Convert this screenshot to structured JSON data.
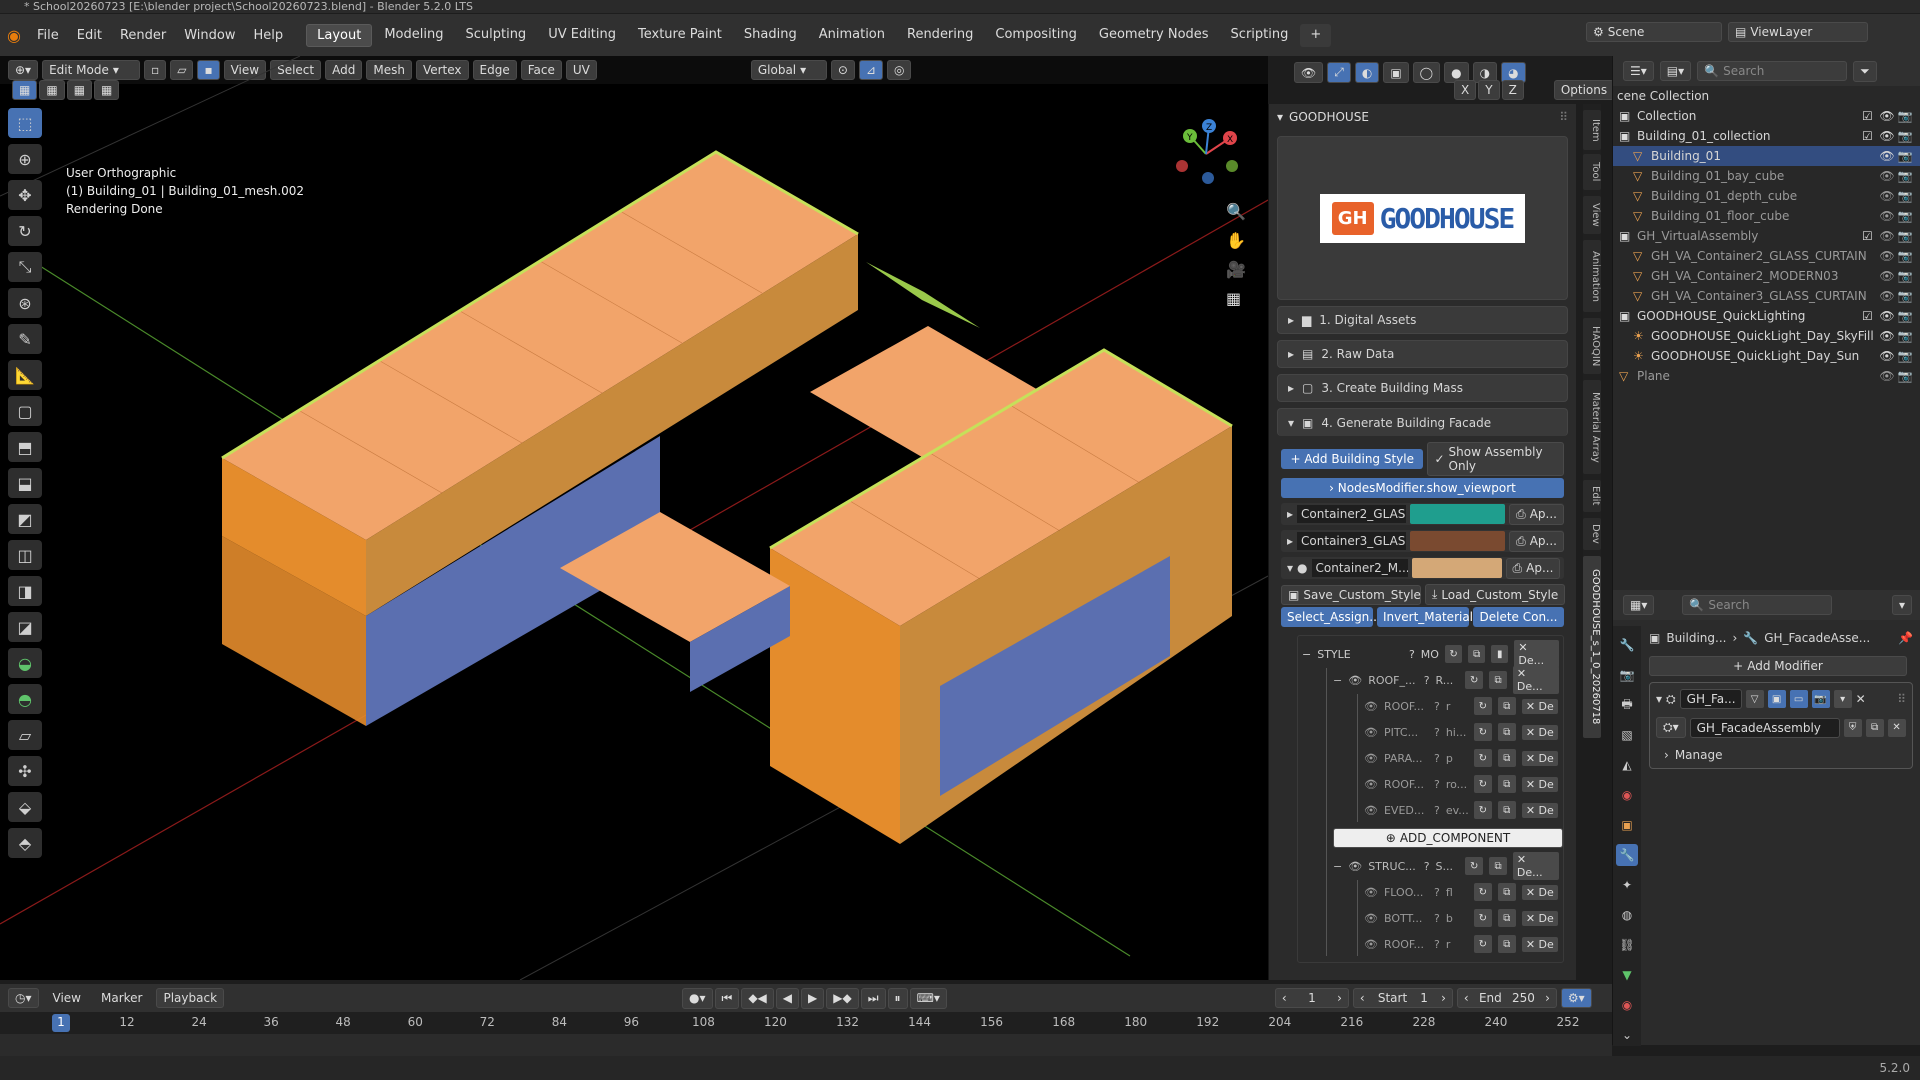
{
  "window": {
    "title": "* School20260723 [E:\\blender project\\School20260723.blend] - Blender 5.2.0 LTS"
  },
  "menu": [
    "File",
    "Edit",
    "Render",
    "Window",
    "Help"
  ],
  "workspaces": [
    "Layout",
    "Modeling",
    "Sculpting",
    "UV Editing",
    "Texture Paint",
    "Shading",
    "Animation",
    "Rendering",
    "Compositing",
    "Geometry Nodes",
    "Scripting"
  ],
  "active_workspace": "Layout",
  "scene": {
    "name": "Scene",
    "view_layer": "ViewLayer"
  },
  "viewport": {
    "mode": "Edit Mode",
    "menus": [
      "View",
      "Select",
      "Add",
      "Mesh",
      "Vertex",
      "Edge",
      "Face",
      "UV"
    ],
    "transform_orientation": "Global",
    "options": "Options",
    "axes": [
      "X",
      "Y",
      "Z"
    ],
    "overlay": {
      "view": "User Orthographic",
      "object": "(1) Building_01 | Building_01_mesh.002",
      "status": "Rendering Done"
    }
  },
  "npanel": {
    "title": "GOODHOUSE",
    "logo_text": "GOODHOUSE",
    "logo_mark": "GH",
    "sections": [
      "1. Digital Assets",
      "2. Raw Data",
      "3. Create Building Mass",
      "4. Generate Building Facade"
    ],
    "add_style": "Add Building Style",
    "show_assembly": "Show Assembly Only",
    "nodes_modifier": "NodesModifier.show_viewport",
    "containers": [
      {
        "name": "Container2_GLAS...",
        "color": "#1f9e8e",
        "apply": "Ap..."
      },
      {
        "name": "Container3_GLAS...",
        "color": "#7a4a30",
        "apply": "Ap..."
      },
      {
        "name": "Container2_M...",
        "color": "#d4a877",
        "apply": "Ap..."
      }
    ],
    "custom_style": {
      "save": "Save_Custom_Style",
      "load": "Load_Custom_Style"
    },
    "assign_row": [
      "Select_Assign...",
      "Invert_Material...",
      "Delete Con..."
    ],
    "style": {
      "label": "STYLE",
      "mode": "MO",
      "delete": "De..."
    },
    "roof_group": {
      "label": "ROOF_...",
      "short": "R...",
      "delete": "De..."
    },
    "roof_items": [
      {
        "name": "ROOF...",
        "sub": "r"
      },
      {
        "name": "PITC...",
        "sub": "hi..."
      },
      {
        "name": "PARA...",
        "sub": "p"
      },
      {
        "name": "ROOF...",
        "sub": "ro..."
      },
      {
        "name": "EVED...",
        "sub": "ev..."
      }
    ],
    "add_component": "ADD_COMPONENT",
    "struct_group": {
      "label": "STRUC...",
      "short": "S...",
      "delete": "De..."
    },
    "struct_items": [
      {
        "name": "FLOO...",
        "sub": "fl"
      },
      {
        "name": "BOTT...",
        "sub": "b"
      },
      {
        "name": "ROOF...",
        "sub": "r"
      }
    ],
    "del_short": "De",
    "vtabs": [
      "Item",
      "Tool",
      "View",
      "Animation",
      "HAOQIN",
      "Material Array",
      "Edit",
      "Dev",
      "GOODHOUSE_s_1_0_20260718"
    ]
  },
  "outliner": {
    "search_placeholder": "Search",
    "root": "cene Collection",
    "rows": [
      {
        "name": "Collection",
        "indent": 0,
        "kind": "collection",
        "check": true
      },
      {
        "name": "Building_01_collection",
        "indent": 0,
        "kind": "collection",
        "check": true
      },
      {
        "name": "Building_01",
        "indent": 1,
        "kind": "mesh",
        "selected": true
      },
      {
        "name": "Building_01_bay_cube",
        "indent": 1,
        "kind": "mesh",
        "dim": true
      },
      {
        "name": "Building_01_depth_cube",
        "indent": 1,
        "kind": "mesh",
        "dim": true
      },
      {
        "name": "Building_01_floor_cube",
        "indent": 1,
        "kind": "mesh",
        "dim": true
      },
      {
        "name": "GH_VirtualAssembly",
        "indent": 0,
        "kind": "collection",
        "check": true,
        "dim": true
      },
      {
        "name": "GH_VA_Container2_GLASS_CURTAIN",
        "indent": 1,
        "kind": "mesh",
        "dim": true
      },
      {
        "name": "GH_VA_Container2_MODERN03",
        "indent": 1,
        "kind": "mesh",
        "dim": true
      },
      {
        "name": "GH_VA_Container3_GLASS_CURTAIN",
        "indent": 1,
        "kind": "mesh",
        "dim": true
      },
      {
        "name": "GOODHOUSE_QuickLighting",
        "indent": 0,
        "kind": "collection",
        "check": true
      },
      {
        "name": "GOODHOUSE_QuickLight_Day_SkyFill",
        "indent": 1,
        "kind": "light"
      },
      {
        "name": "GOODHOUSE_QuickLight_Day_Sun",
        "indent": 1,
        "kind": "light"
      },
      {
        "name": "Plane",
        "indent": 0,
        "kind": "mesh",
        "dim": true
      }
    ]
  },
  "properties": {
    "search_placeholder": "Search",
    "breadcrumb_obj": "Building...",
    "breadcrumb_mod": "GH_FacadeAsse...",
    "add_modifier": "Add Modifier",
    "modifier_name": "GH_Fa...",
    "node_group": "GH_FacadeAssembly",
    "manage": "Manage"
  },
  "timeline": {
    "menus": [
      "View",
      "Marker",
      "Playback"
    ],
    "current_frame": "1",
    "start_label": "Start",
    "start": "1",
    "end_label": "End",
    "end": "250",
    "ticks": [
      "1",
      "12",
      "24",
      "36",
      "48",
      "60",
      "72",
      "84",
      "96",
      "108",
      "120",
      "132",
      "144",
      "156",
      "168",
      "180",
      "192",
      "204",
      "216",
      "228",
      "240",
      "252"
    ]
  },
  "version": "5.2.0"
}
